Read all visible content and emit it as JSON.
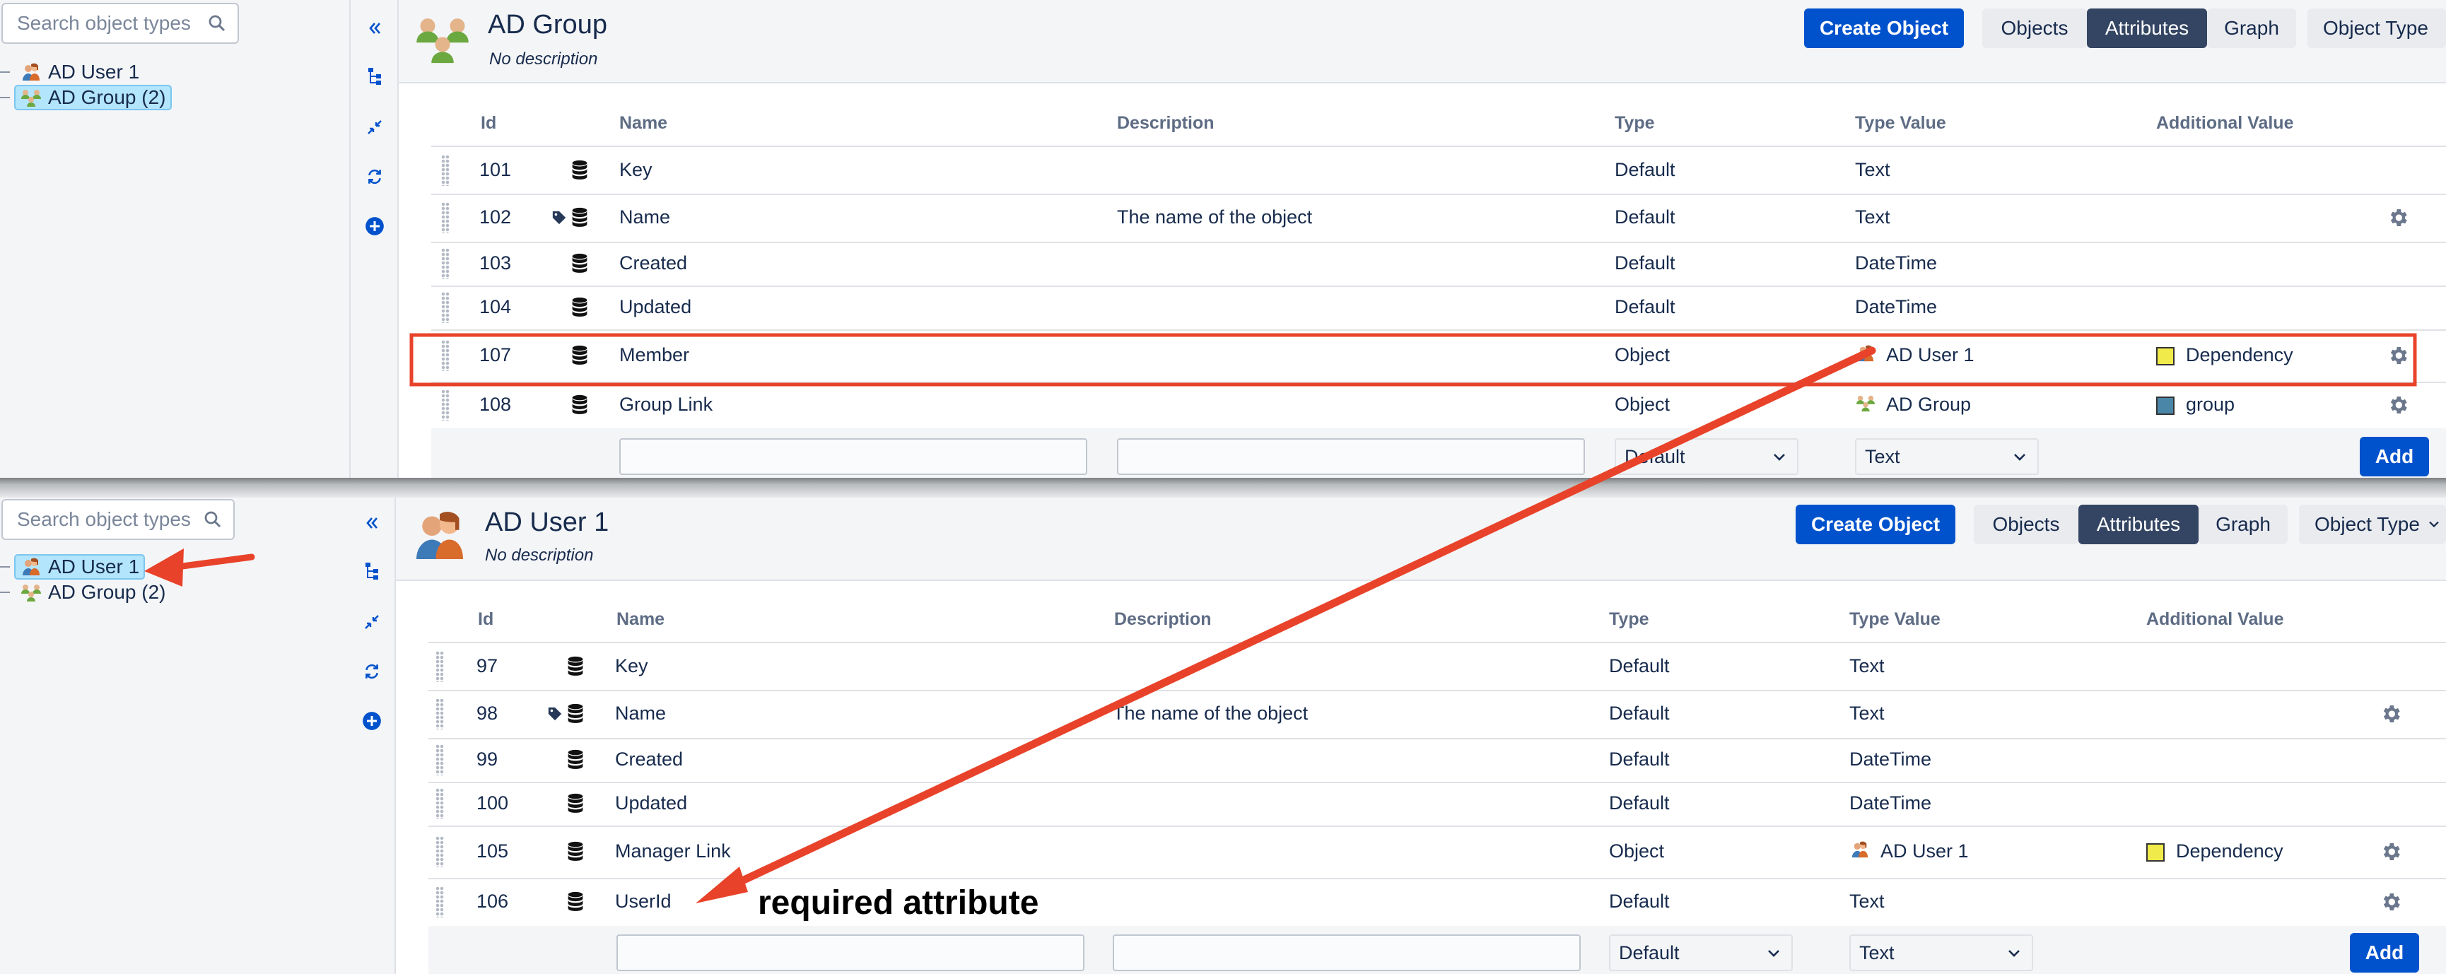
{
  "top": {
    "search_placeholder": "Search object types",
    "tree": [
      {
        "label": "AD User 1",
        "icon": "users-icon",
        "selected": false
      },
      {
        "label": "AD Group (2)",
        "icon": "group-icon",
        "selected": true
      }
    ],
    "header": {
      "title": "AD Group",
      "subtitle": "No description"
    },
    "buttons": {
      "create": "Create Object",
      "objects": "Objects",
      "attributes": "Attributes",
      "graph": "Graph",
      "object_type": "Object Type"
    },
    "columns": [
      "Id",
      "Name",
      "Description",
      "Type",
      "Type Value",
      "Additional Value"
    ],
    "rows": [
      {
        "id": "101",
        "name": "Key",
        "description": "",
        "type": "Default",
        "type_value": "Text",
        "additional": "",
        "tag": false,
        "gear": false
      },
      {
        "id": "102",
        "name": "Name",
        "description": "The name of the object",
        "type": "Default",
        "type_value": "Text",
        "additional": "",
        "tag": true,
        "gear": true
      },
      {
        "id": "103",
        "name": "Created",
        "description": "",
        "type": "Default",
        "type_value": "DateTime",
        "additional": "",
        "tag": false,
        "gear": false
      },
      {
        "id": "104",
        "name": "Updated",
        "description": "",
        "type": "Default",
        "type_value": "DateTime",
        "additional": "",
        "tag": false,
        "gear": false
      },
      {
        "id": "107",
        "name": "Member",
        "description": "",
        "type": "Object",
        "type_value": "AD User 1",
        "type_value_icon": "users-icon",
        "additional": "Dependency",
        "additional_color": "#f0ea4a",
        "tag": false,
        "gear": true
      },
      {
        "id": "108",
        "name": "Group Link",
        "description": "",
        "type": "Object",
        "type_value": "AD Group",
        "type_value_icon": "group-icon",
        "additional": "group",
        "additional_color": "#4a86a8",
        "tag": false,
        "gear": true
      }
    ],
    "add_row": {
      "type_select": "Default",
      "type_value_select": "Text",
      "add_label": "Add"
    }
  },
  "bottom": {
    "search_placeholder": "Search object types",
    "tree": [
      {
        "label": "AD User 1",
        "icon": "users-icon",
        "selected": true
      },
      {
        "label": "AD Group (2)",
        "icon": "group-icon",
        "selected": false
      }
    ],
    "header": {
      "title": "AD User 1",
      "subtitle": "No description"
    },
    "buttons": {
      "create": "Create Object",
      "objects": "Objects",
      "attributes": "Attributes",
      "graph": "Graph",
      "object_type": "Object Type"
    },
    "columns": [
      "Id",
      "Name",
      "Description",
      "Type",
      "Type Value",
      "Additional Value"
    ],
    "rows": [
      {
        "id": "97",
        "name": "Key",
        "description": "",
        "type": "Default",
        "type_value": "Text",
        "additional": "",
        "tag": false,
        "gear": false
      },
      {
        "id": "98",
        "name": "Name",
        "description": "The name of the object",
        "type": "Default",
        "type_value": "Text",
        "additional": "",
        "tag": true,
        "gear": true
      },
      {
        "id": "99",
        "name": "Created",
        "description": "",
        "type": "Default",
        "type_value": "DateTime",
        "additional": "",
        "tag": false,
        "gear": false
      },
      {
        "id": "100",
        "name": "Updated",
        "description": "",
        "type": "Default",
        "type_value": "DateTime",
        "additional": "",
        "tag": false,
        "gear": false
      },
      {
        "id": "105",
        "name": "Manager Link",
        "description": "",
        "type": "Object",
        "type_value": "AD User 1",
        "type_value_icon": "users-icon",
        "additional": "Dependency",
        "additional_color": "#f0ea4a",
        "tag": false,
        "gear": true
      },
      {
        "id": "106",
        "name": "UserId",
        "description": "",
        "type": "Default",
        "type_value": "Text",
        "additional": "",
        "tag": false,
        "gear": true
      }
    ],
    "add_row": {
      "type_select": "Default",
      "type_value_select": "Text",
      "add_label": "Add"
    }
  },
  "annotation": {
    "label": "required attribute",
    "color": "#e8432a"
  },
  "colors": {
    "primary": "#0052cc",
    "selected_tab": "#344563",
    "highlight": "#e8432a"
  }
}
